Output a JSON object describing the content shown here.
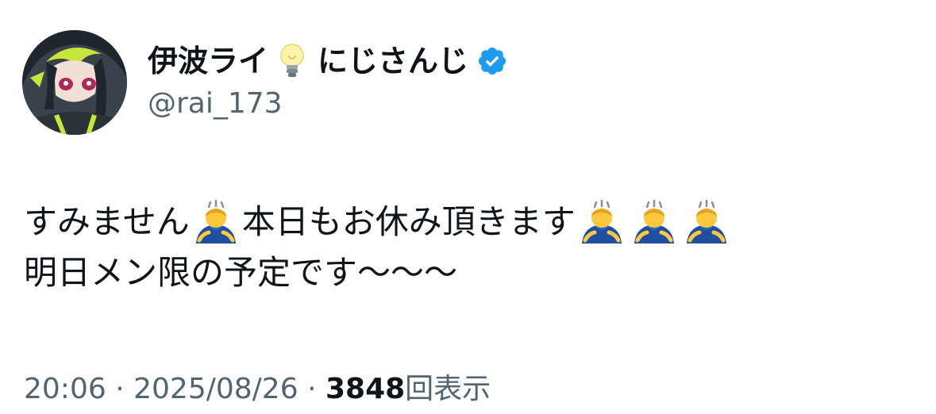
{
  "author": {
    "display_name": "伊波ライ",
    "display_name_suffix": "にじさんじ",
    "name_emoji": "light-bulb-icon",
    "handle": "@rai_173",
    "verified": true
  },
  "tweet": {
    "line1_part1": "すみません",
    "line1_part2": "本日もお休み頂きます",
    "line2": "明日メン限の予定です〜〜〜",
    "emoji": "person-bowing-icon"
  },
  "meta": {
    "time": "20:06",
    "separator": "·",
    "date": "2025/08/26",
    "views_count": "3848",
    "views_label": "回表示"
  },
  "colors": {
    "text_primary": "#0f1419",
    "text_secondary": "#536471",
    "verified_blue": "#1d9bf0",
    "background": "#ffffff"
  }
}
